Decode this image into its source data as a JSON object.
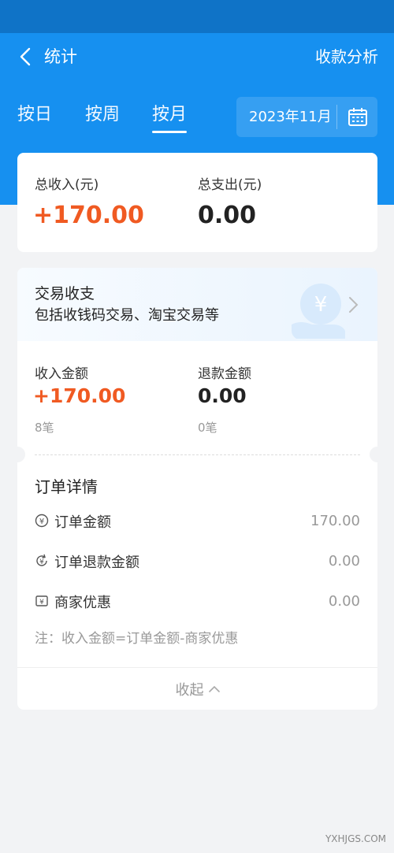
{
  "colors": {
    "header_blue": "#1690f0",
    "status_blue": "#0f73c7",
    "accent_orange": "#f05a22"
  },
  "nav": {
    "title": "统计",
    "right_link": "收款分析",
    "back_icon": "chevron-left-icon"
  },
  "tabs": [
    {
      "label": "按日",
      "active": false
    },
    {
      "label": "按周",
      "active": false
    },
    {
      "label": "按月",
      "active": true
    }
  ],
  "date_picker": {
    "value": "2023年11月",
    "icon": "calendar-icon"
  },
  "summary": {
    "income_label": "总收入(元)",
    "income_value": "+170.00",
    "expense_label": "总支出(元)",
    "expense_value": "0.00"
  },
  "trade": {
    "title": "交易收支",
    "subtitle": "包括收钱码交易、淘宝交易等",
    "income_label": "收入金额",
    "income_value": "+170.00",
    "income_count": "8笔",
    "refund_label": "退款金额",
    "refund_value": "0.00",
    "refund_count": "0笔"
  },
  "order_detail": {
    "title": "订单详情",
    "rows": [
      {
        "label": "订单金额",
        "value": "170.00",
        "icon": "yuan-circle-icon"
      },
      {
        "label": "订单退款金额",
        "value": "0.00",
        "icon": "refund-icon"
      },
      {
        "label": "商家优惠",
        "value": "0.00",
        "icon": "coupon-icon"
      }
    ],
    "note": "注：收入金额=订单金额-商家优惠"
  },
  "collapse_label": "收起",
  "watermark": "YXHJGS.COM"
}
